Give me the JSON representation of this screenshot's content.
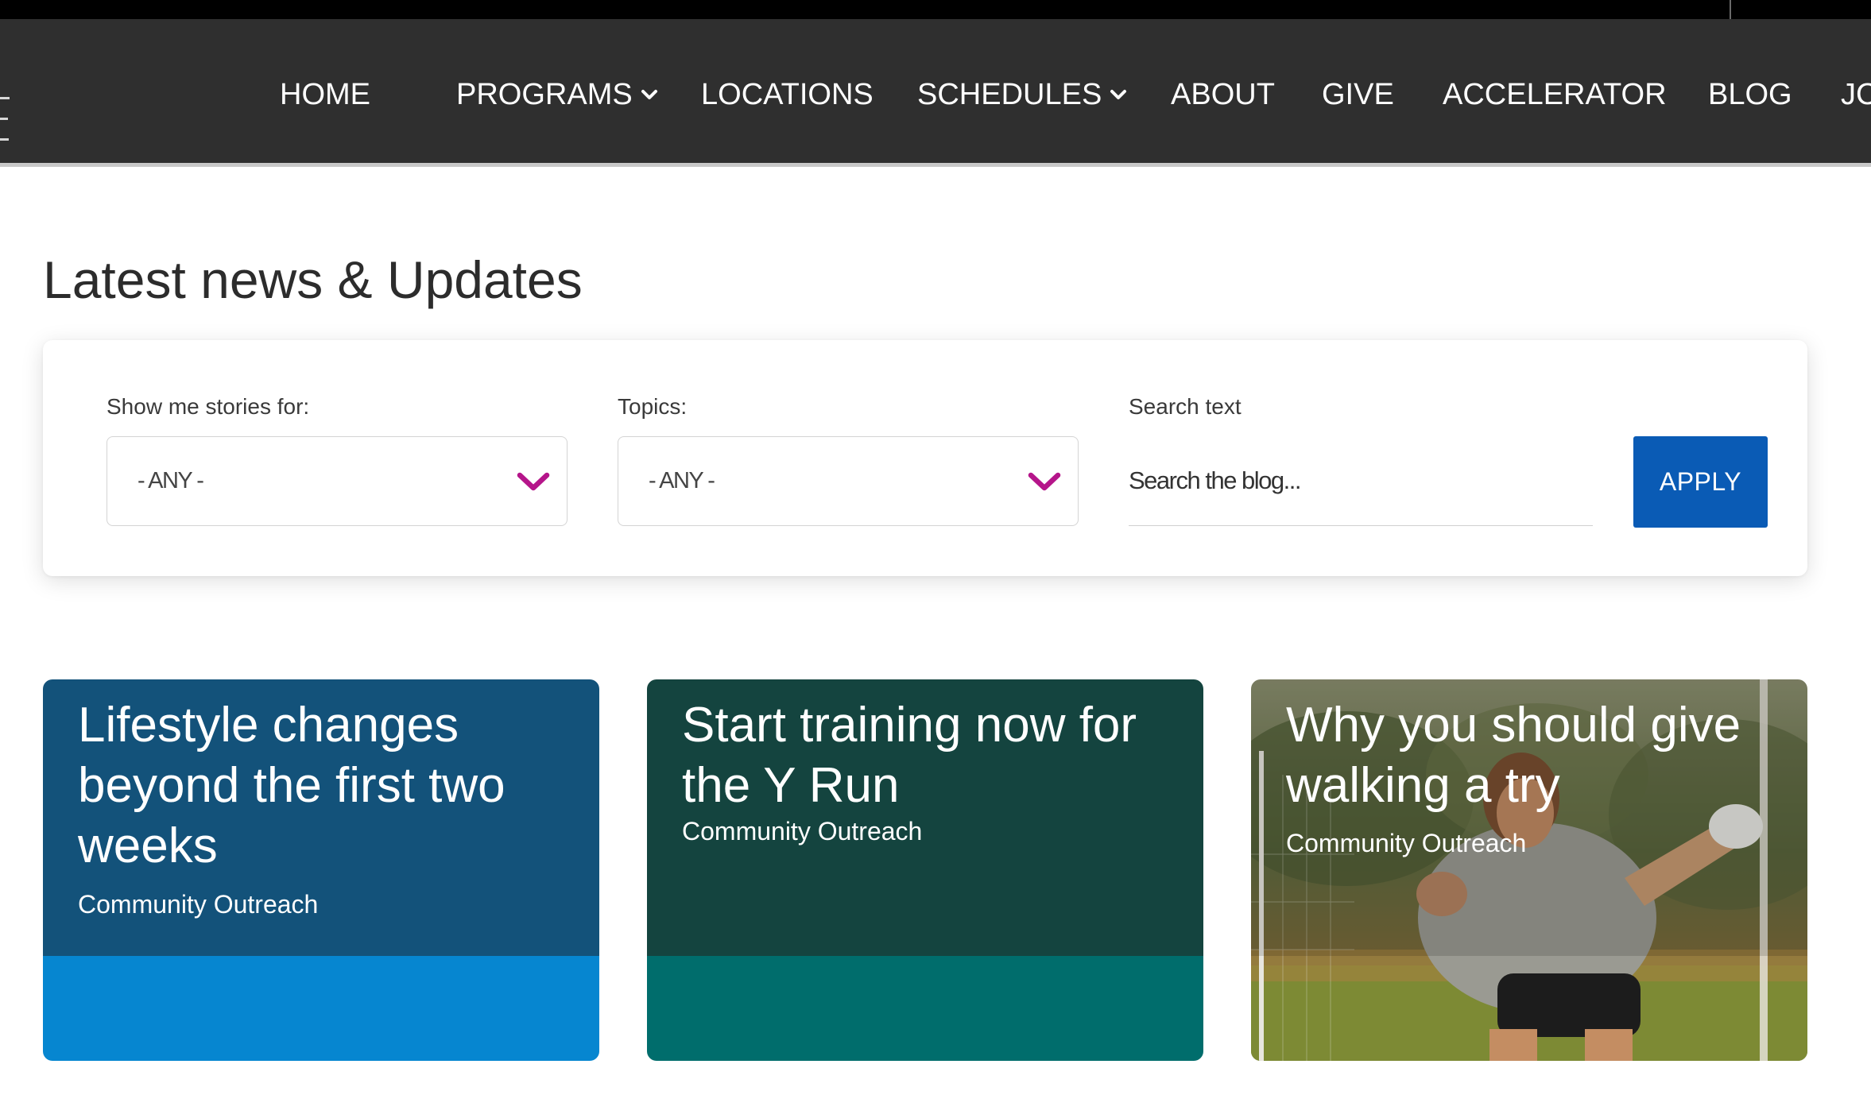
{
  "nav": {
    "items": [
      {
        "label": "HOME",
        "has_dropdown": false
      },
      {
        "label": "PROGRAMS",
        "has_dropdown": true
      },
      {
        "label": "LOCATIONS",
        "has_dropdown": false
      },
      {
        "label": "SCHEDULES",
        "has_dropdown": true
      },
      {
        "label": "ABOUT",
        "has_dropdown": false
      },
      {
        "label": "GIVE",
        "has_dropdown": false
      },
      {
        "label": "ACCELERATOR",
        "has_dropdown": false
      },
      {
        "label": "BLOG",
        "has_dropdown": false
      },
      {
        "label": "JC",
        "has_dropdown": false
      }
    ],
    "dropdown_icon": "chevron-down-icon"
  },
  "page": {
    "title": "Latest news & Updates"
  },
  "filters": {
    "stories": {
      "label": "Show me stories for:",
      "value": "- ANY -"
    },
    "topics": {
      "label": "Topics:",
      "value": "- ANY -"
    },
    "search": {
      "label": "Search text",
      "placeholder": "Search the blog..."
    },
    "apply_label": "APPLY",
    "chevron_icon": "chevron-down-icon"
  },
  "cards": [
    {
      "title": "Lifestyle changes beyond the first two weeks",
      "tag": "Community Outreach",
      "top_color": "#13527a",
      "bottom_color": "#0686d0"
    },
    {
      "title": "Start training now for the Y Run",
      "tag": "Community Outreach",
      "top_color": "#14443f",
      "bottom_color": "#006d6c"
    },
    {
      "title": "Why you should give walking a try",
      "tag": "Community Outreach",
      "image": "photo of a goalkeeper in a grey shirt and black shorts on a grass field beside a goal net"
    }
  ],
  "colors": {
    "nav_bg": "#2f2f2f",
    "accent_chevron": "#b5158a",
    "apply_button": "#0a5bb5",
    "title_text": "#2c2c2c"
  }
}
